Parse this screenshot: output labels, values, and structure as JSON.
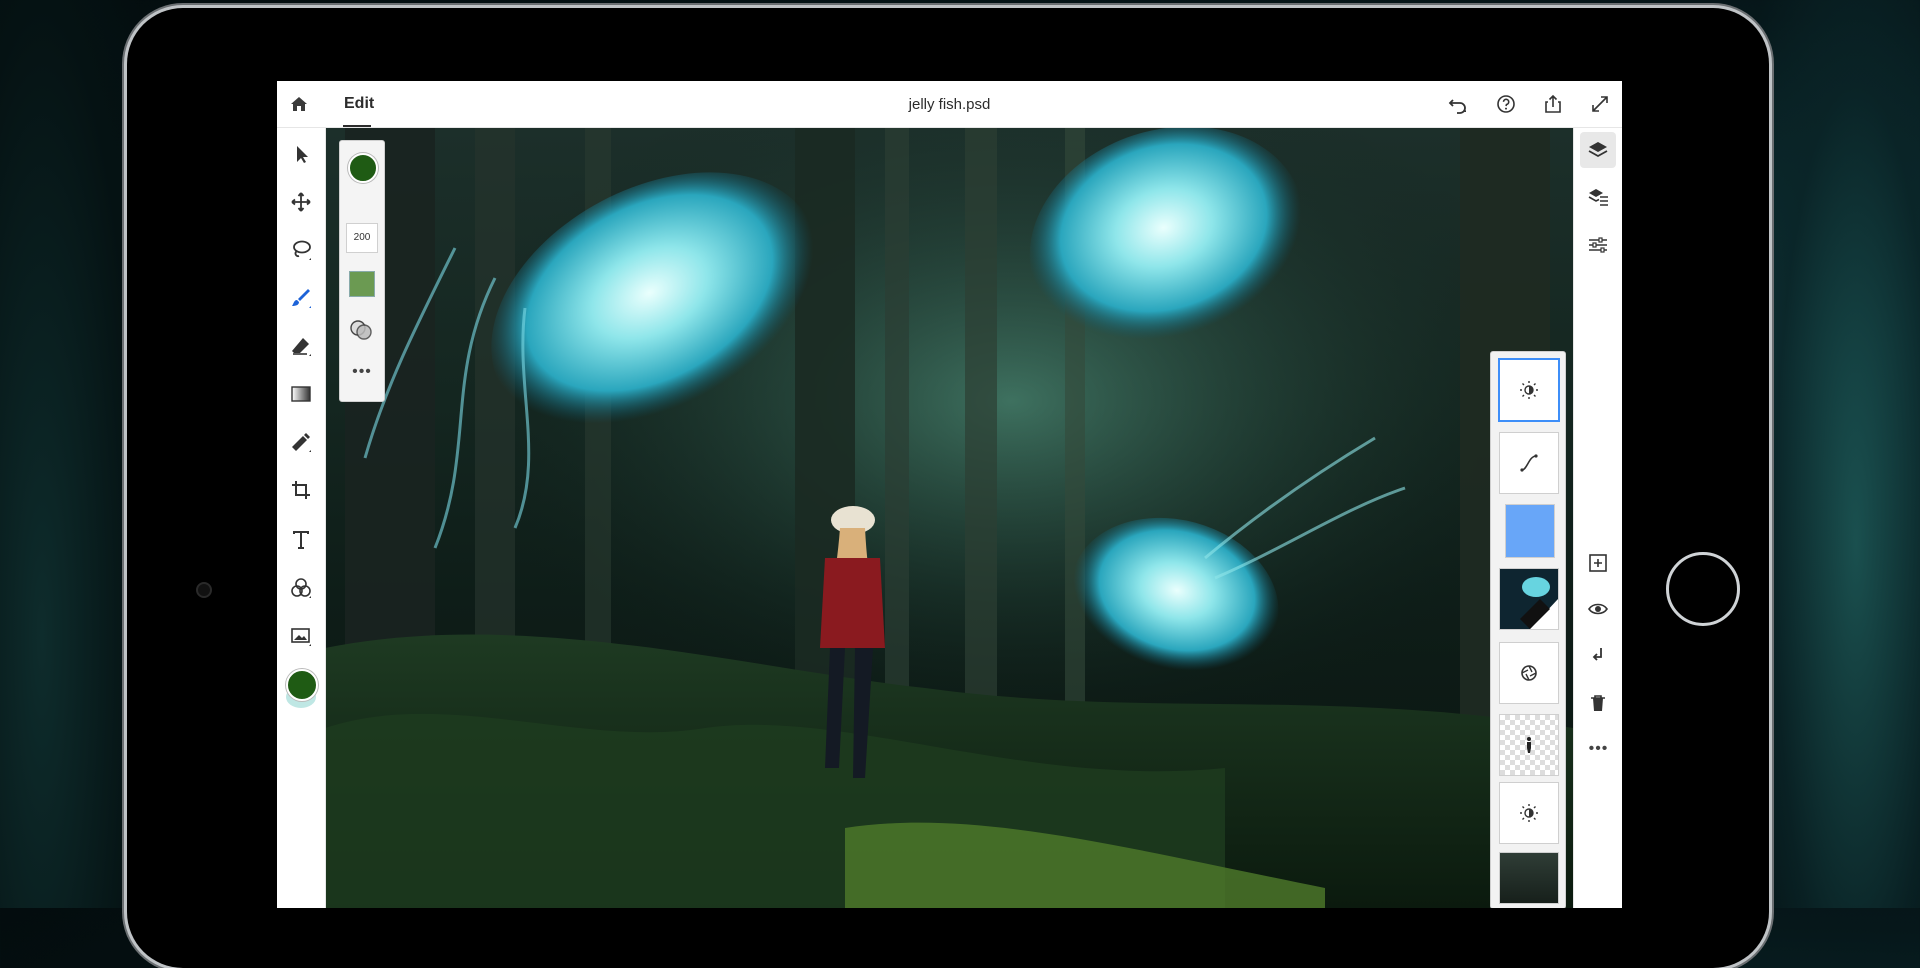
{
  "header": {
    "mode_label": "Edit",
    "document_title": "jelly fish.psd"
  },
  "icons": {
    "home": "home-icon",
    "undo": "undo-icon",
    "help": "help-icon",
    "share": "share-icon",
    "fullscreen": "fullscreen-icon"
  },
  "toolbar": {
    "tools": [
      "select-tool",
      "move-tool",
      "lasso-tool",
      "brush-tool",
      "eraser-tool",
      "gradient-tool",
      "healing-tool",
      "crop-tool",
      "type-tool",
      "adjustment-tool",
      "place-image-tool"
    ],
    "active_tool": "brush-tool",
    "foreground_color": "#1f5b14"
  },
  "brush_panel": {
    "color": "#1f5b14",
    "size": "200",
    "swatch_color": "#6b9a52",
    "more": "•••"
  },
  "layers_panel": {
    "layers": [
      {
        "type": "brightness-adjustment",
        "selected": true
      },
      {
        "type": "curves-adjustment",
        "selected": false
      },
      {
        "type": "color-fill",
        "color": "#68a6f8",
        "selected": false
      },
      {
        "type": "jellyfish-image",
        "selected": false
      },
      {
        "type": "aperture-adjustment",
        "selected": false
      },
      {
        "type": "figure-cutout",
        "selected": false
      },
      {
        "type": "brightness-adjustment",
        "selected": false
      },
      {
        "type": "forest-image",
        "selected": false
      }
    ]
  },
  "right_panel": {
    "more": "•••"
  },
  "colors": {
    "selection_accent": "#3d8ef8",
    "brush_active": "#1d63d8"
  }
}
